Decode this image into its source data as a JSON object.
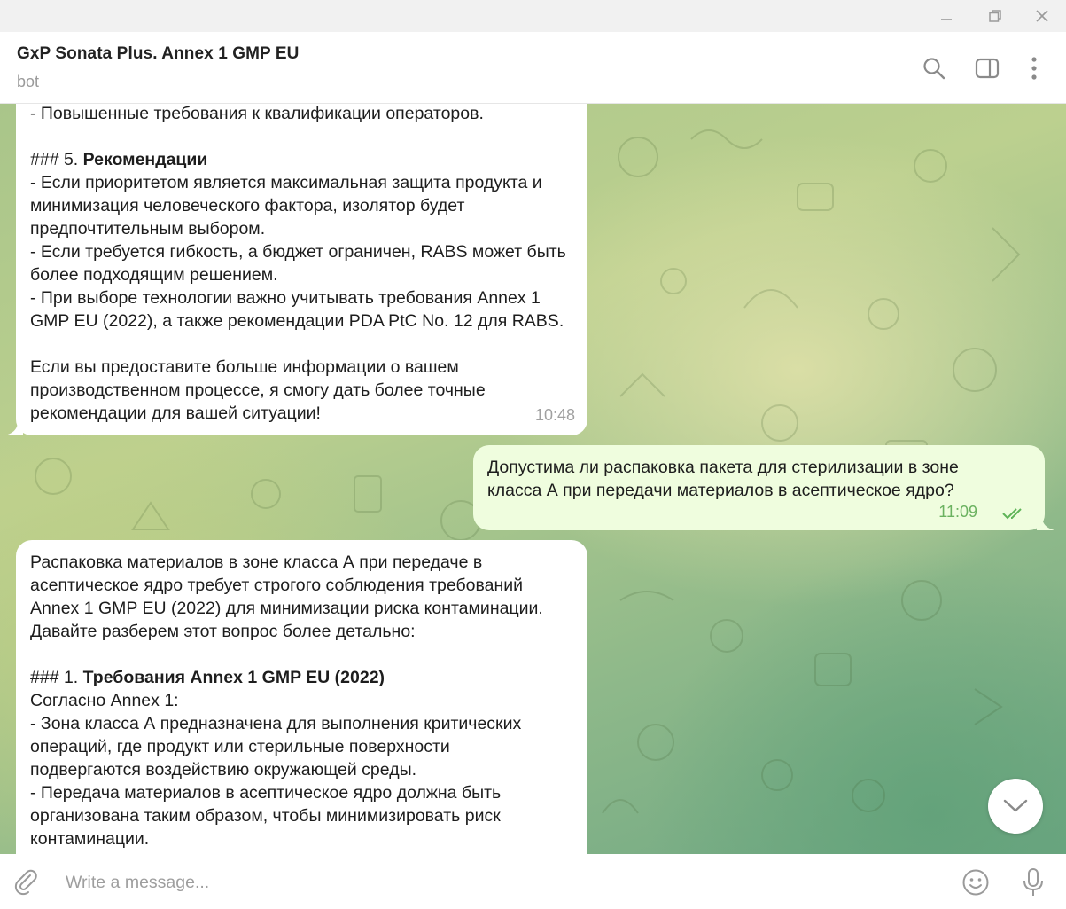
{
  "window": {
    "controls": {
      "minimize": "minimize-icon",
      "restore": "restore-icon",
      "close": "close-icon"
    }
  },
  "header": {
    "title": "GxP Sonata Plus. Annex 1 GMP EU",
    "status": "bot",
    "icons": [
      "search-icon",
      "sidebar-toggle-icon",
      "more-vertical-icon"
    ]
  },
  "messages": [
    {
      "direction": "incoming",
      "lines": [
        {
          "text": "- Повышенные требования к квалификации операторов."
        },
        {
          "text": ""
        },
        {
          "prefix": "### 5. ",
          "bold": "Рекомендации"
        },
        {
          "text": "- Если приоритетом является максимальная защита продукта и"
        },
        {
          "text": "минимизация человеческого фактора, изолятор будет"
        },
        {
          "text": "предпочтительным выбором."
        },
        {
          "text": "- Если требуется гибкость, а бюджет ограничен, RABS может быть"
        },
        {
          "text": "более подходящим решением."
        },
        {
          "text": "- При выборе технологии важно учитывать требования Annex 1"
        },
        {
          "text": "GMP EU (2022), а также рекомендации PDA PtC No. 12 для RABS."
        },
        {
          "text": ""
        },
        {
          "text": "Если вы предоставите больше информации о вашем"
        },
        {
          "text": "производственном процессе, я смогу дать более точные"
        },
        {
          "text": "рекомендации для вашей ситуации!"
        }
      ],
      "time": "10:48"
    },
    {
      "direction": "outgoing",
      "lines": [
        {
          "text": "Допустима ли распаковка пакета для стерилизации в зоне"
        },
        {
          "text": "класса А при передачи материалов в асептическое ядро?"
        }
      ],
      "time": "11:09",
      "status_icon": "double-check-icon"
    },
    {
      "direction": "incoming",
      "lines": [
        {
          "text": "Распаковка материалов в зоне класса А при передаче в"
        },
        {
          "text": "асептическое ядро требует строгого соблюдения требований"
        },
        {
          "text": "Annex 1 GMP EU (2022) для минимизации риска контаминации."
        },
        {
          "text": "Давайте разберем этот вопрос более детально:"
        },
        {
          "text": ""
        },
        {
          "prefix": "### 1. ",
          "bold": "Требования Annex 1 GMP EU (2022)"
        },
        {
          "text": "Согласно Annex 1:"
        },
        {
          "text": "- Зона класса А предназначена для выполнения критических"
        },
        {
          "text": "операций, где продукт или стерильные поверхности"
        },
        {
          "text": "подвергаются воздействию окружающей среды."
        },
        {
          "text": "- Передача материалов в асептическое ядро должна быть"
        },
        {
          "text": "организована таким образом, чтобы минимизировать риск"
        },
        {
          "text": "контаминации."
        }
      ],
      "time": ""
    }
  ],
  "composer": {
    "placeholder": "Write a message...",
    "icons": [
      "attach-icon",
      "emoji-icon",
      "microphone-icon"
    ]
  },
  "scroll_button": {
    "icon": "chevron-down-icon"
  }
}
